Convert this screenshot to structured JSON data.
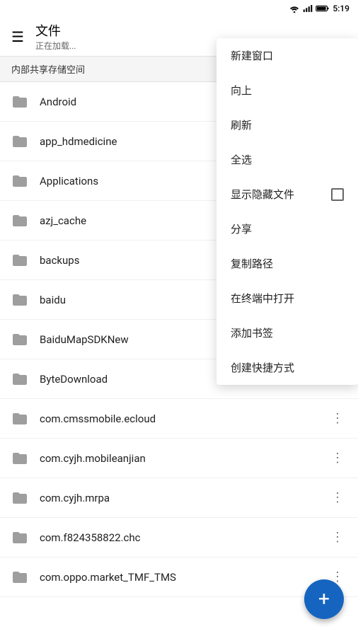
{
  "statusBar": {
    "time": "5:19",
    "icons": [
      "wifi",
      "signal",
      "battery"
    ]
  },
  "header": {
    "title": "文件",
    "subtitle": "正在加载...",
    "menuIconLabel": "menu"
  },
  "storageLabel": "内部共享存储空间",
  "files": [
    {
      "id": 1,
      "name": "Android",
      "hasMore": false
    },
    {
      "id": 2,
      "name": "app_hdmedicine",
      "hasMore": false
    },
    {
      "id": 3,
      "name": "Applications",
      "hasMore": false
    },
    {
      "id": 4,
      "name": "azj_cache",
      "hasMore": false
    },
    {
      "id": 5,
      "name": "backups",
      "hasMore": false
    },
    {
      "id": 6,
      "name": "baidu",
      "hasMore": false
    },
    {
      "id": 7,
      "name": "BaiduMapSDKNew",
      "hasMore": true
    },
    {
      "id": 8,
      "name": "ByteDownload",
      "hasMore": true
    },
    {
      "id": 9,
      "name": "com.cmssmobile.ecloud",
      "hasMore": true
    },
    {
      "id": 10,
      "name": "com.cyjh.mobileanjian",
      "hasMore": true
    },
    {
      "id": 11,
      "name": "com.cyjh.mrpa",
      "hasMore": true
    },
    {
      "id": 12,
      "name": "com.f824358822.chc",
      "hasMore": true
    },
    {
      "id": 13,
      "name": "com.oppo.market_TMF_TMS",
      "hasMore": true
    }
  ],
  "dropdown": {
    "items": [
      {
        "id": "new-window",
        "label": "新建窗口",
        "hasCheckbox": false
      },
      {
        "id": "go-up",
        "label": "向上",
        "hasCheckbox": false
      },
      {
        "id": "refresh",
        "label": "刷新",
        "hasCheckbox": false
      },
      {
        "id": "select-all",
        "label": "全选",
        "hasCheckbox": false
      },
      {
        "id": "show-hidden",
        "label": "显示隐藏文件",
        "hasCheckbox": true
      },
      {
        "id": "share",
        "label": "分享",
        "hasCheckbox": false
      },
      {
        "id": "copy-path",
        "label": "复制路径",
        "hasCheckbox": false
      },
      {
        "id": "open-terminal",
        "label": "在终端中打开",
        "hasCheckbox": false
      },
      {
        "id": "add-bookmark",
        "label": "添加书签",
        "hasCheckbox": false
      },
      {
        "id": "create-shortcut",
        "label": "创建快捷方式",
        "hasCheckbox": false
      }
    ]
  },
  "fab": {
    "label": "+"
  }
}
